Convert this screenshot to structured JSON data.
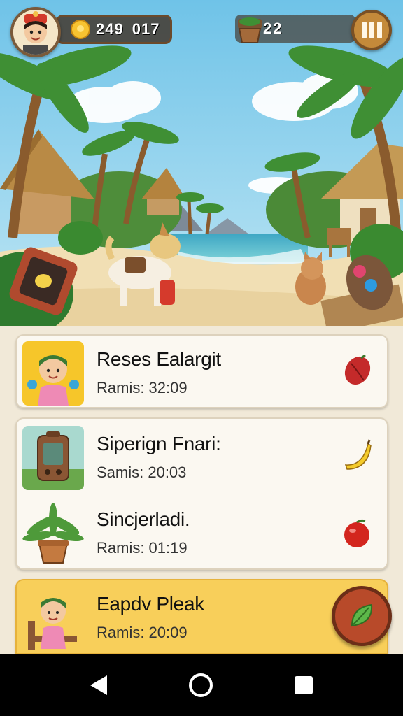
{
  "hud": {
    "coins_primary": "249",
    "coins_secondary": "017",
    "items_count": "22",
    "avatar_icon": "player-avatar-icon",
    "pause_icon": "pause-icon"
  },
  "tasks": [
    {
      "title": "Reses Ealargit",
      "time": "Ramis: 32:09",
      "thumb_icon": "villager-waving-icon",
      "reward_icon": "cocoa-pod-icon"
    },
    {
      "title": "Siperign Fnari:",
      "time": "Samis: 20:03",
      "thumb_icon": "radio-device-icon",
      "reward_icon": "banana-icon"
    },
    {
      "title": "Sincjerladi.",
      "time": "Ramis: 01:19",
      "thumb_icon": "potted-plant-icon",
      "reward_icon": "red-apple-icon"
    },
    {
      "title": "Eapdv Pleak",
      "time": "Ramis: 20:09",
      "thumb_icon": "villager-on-chair-icon",
      "reward_icon": "leaf-action-icon"
    }
  ],
  "colors": {
    "highlight_card": "#f8cf5a",
    "action_button": "#b84a2a",
    "hud_panel": "#463c32"
  }
}
